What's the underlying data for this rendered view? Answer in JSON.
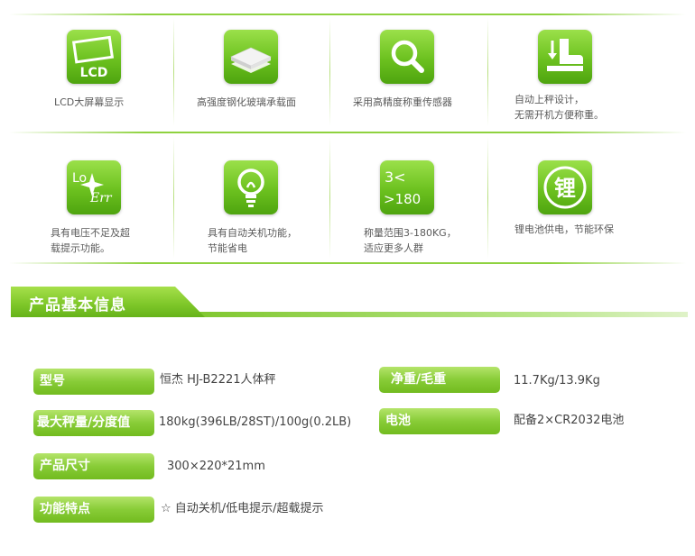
{
  "features": [
    {
      "icon": "lcd-icon",
      "icon_text": "LCD",
      "caption": [
        "LCD大屏幕显示"
      ]
    },
    {
      "icon": "glass-panel-icon",
      "caption": [
        "高强度钢化玻璃承载面"
      ]
    },
    {
      "icon": "magnifier-icon",
      "caption": [
        "采用高精度称重传感器"
      ]
    },
    {
      "icon": "step-on-icon",
      "caption": [
        "自动上秤设计，",
        "无需开机方便称重。"
      ]
    },
    {
      "icon": "lo-err-icon",
      "icon_text": [
        "Lo",
        "Err"
      ],
      "caption": [
        "具有电压不足及超",
        "载提示功能。"
      ]
    },
    {
      "icon": "lightbulb-icon",
      "caption": [
        "具有自动关机功能，",
        "节能省电"
      ]
    },
    {
      "icon": "range-icon",
      "icon_text": [
        "3<",
        ">180"
      ],
      "caption": [
        "称量范围3-180KG，",
        "适应更多人群"
      ]
    },
    {
      "icon": "lithium-icon",
      "icon_text": "锂",
      "caption": [
        "锂电池供电，节能环保"
      ]
    }
  ],
  "section": {
    "title": "产品基本信息"
  },
  "specs": {
    "model": {
      "label": "型号",
      "value": "恒杰 HJ-B2221人体秤"
    },
    "weight": {
      "label": "净重/毛重",
      "value": "11.7Kg/13.9Kg"
    },
    "capacity": {
      "label": "最大秤量/分度值",
      "value": "180kg(396LB/28ST)/100g(0.2LB)"
    },
    "battery": {
      "label": "电池",
      "value": "配备2×CR2032电池"
    },
    "size": {
      "label": "产品尺寸",
      "value": "300×220*21mm"
    },
    "functions": {
      "label": "功能特点",
      "value": "☆ 自动关机/低电提示/超载提示"
    }
  },
  "colors": {
    "accent": "#7dc628",
    "accent_light": "#a6e04b",
    "text": "#555555"
  }
}
